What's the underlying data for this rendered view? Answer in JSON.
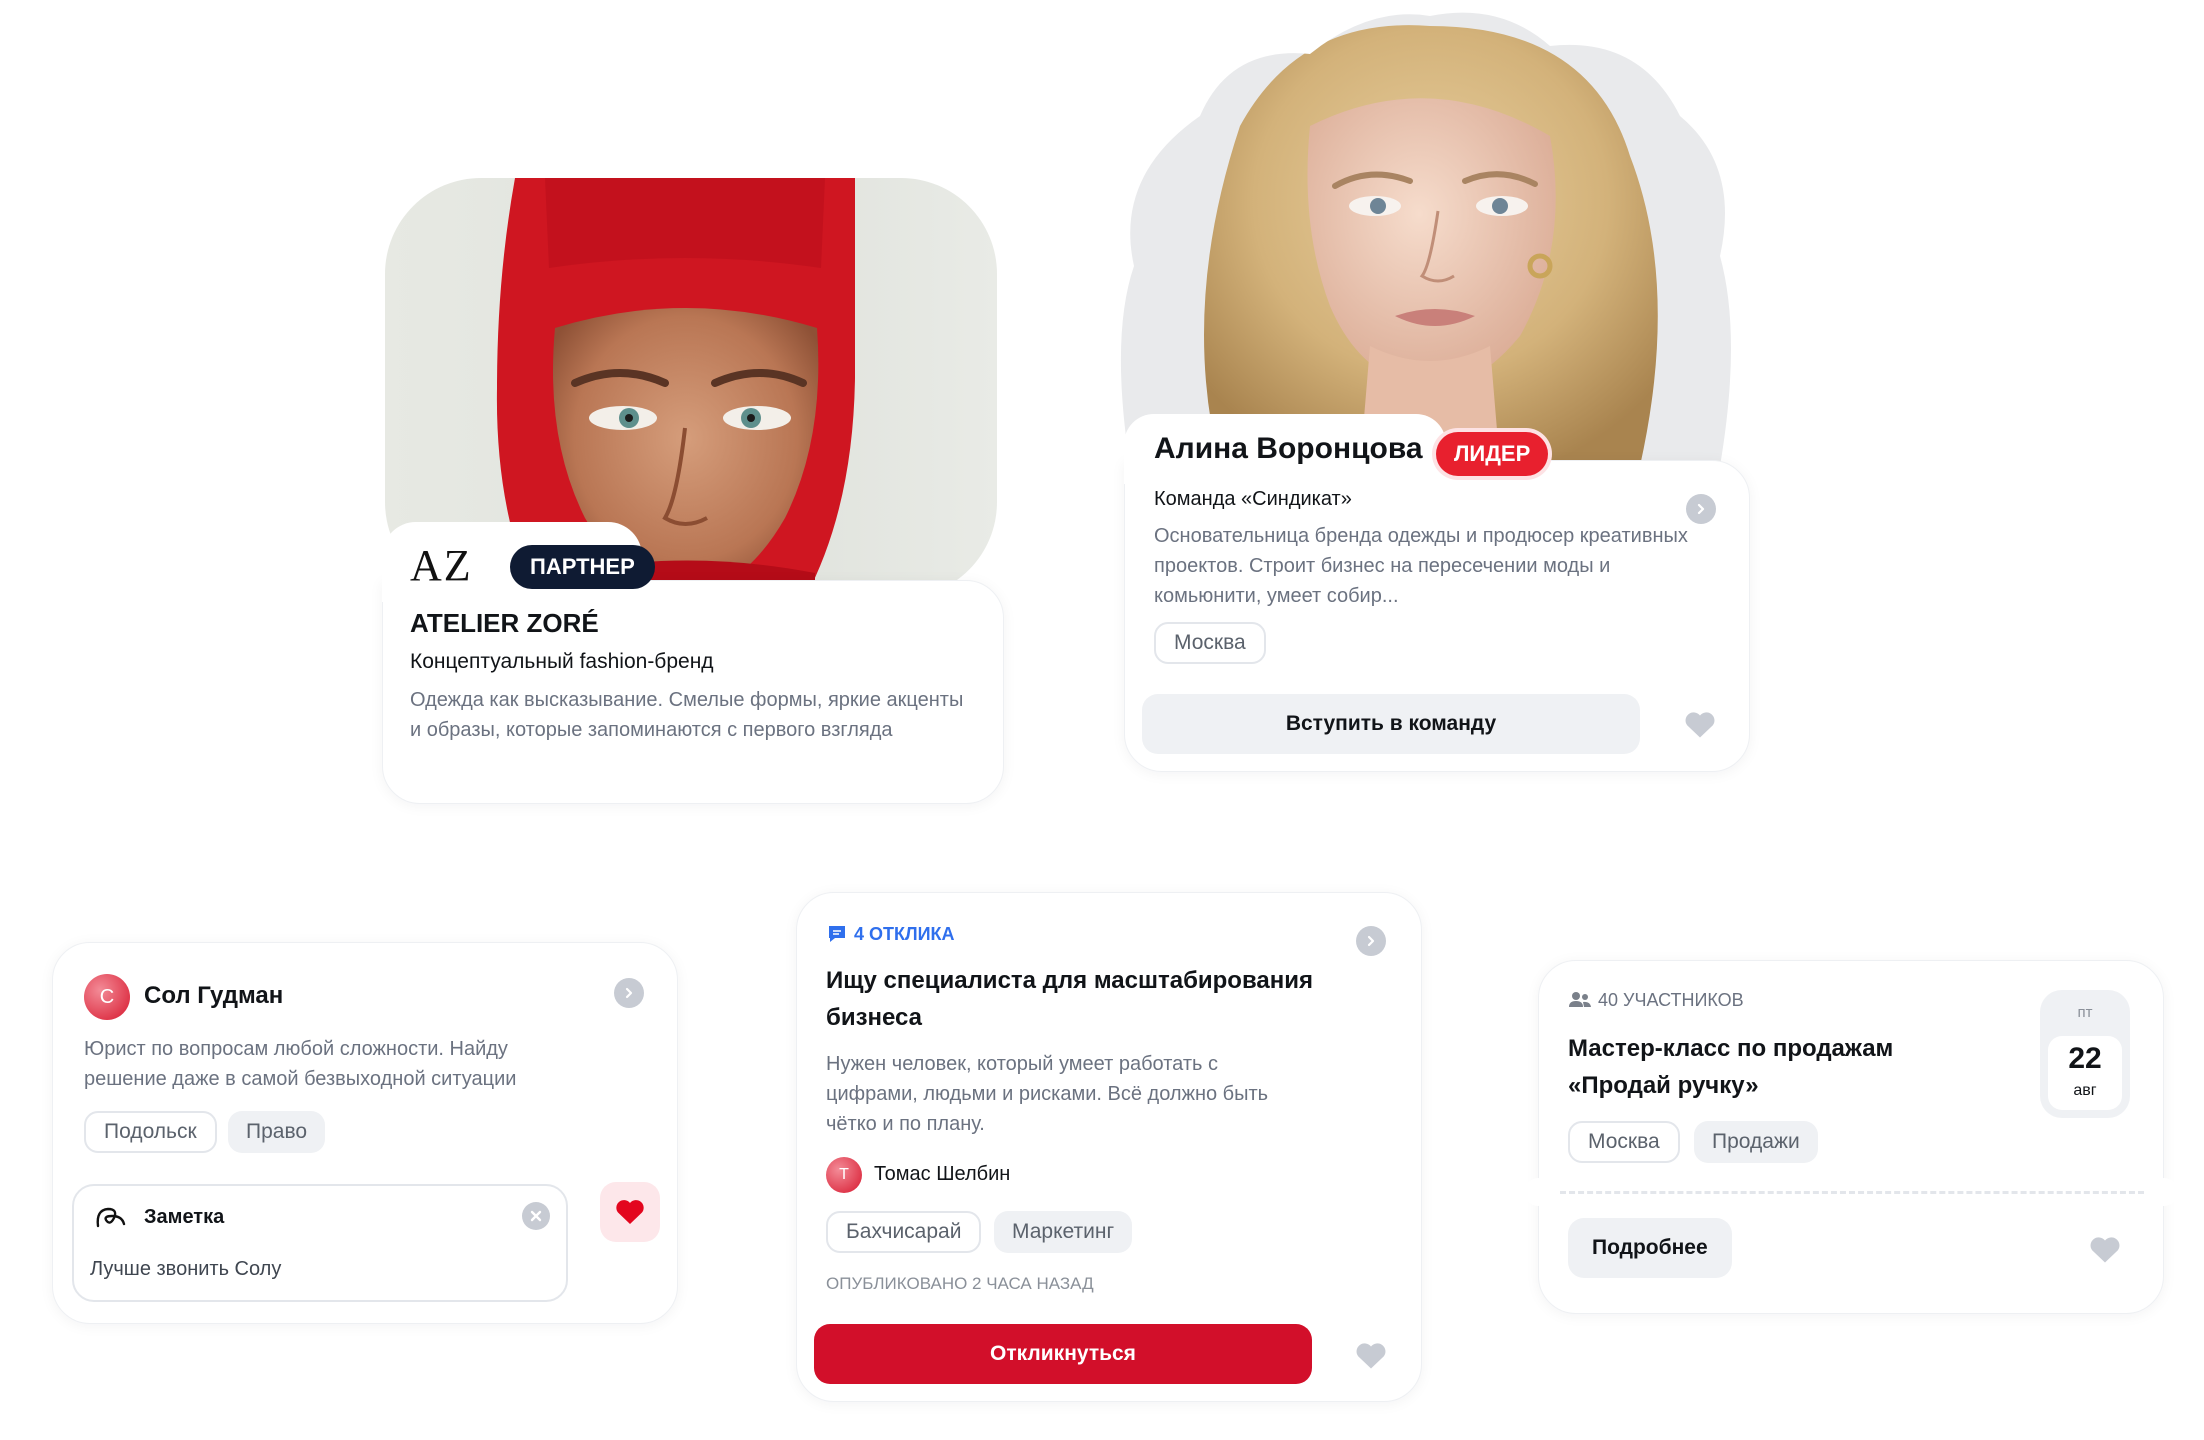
{
  "brand_card": {
    "logo_text": "AZ",
    "badge": "ПАРТНЕР",
    "title": "ATELIER ZORÉ",
    "subtitle": "Концептуальный fashion-бренд",
    "description": "Одежда как высказывание. Смелые формы, яркие акценты и образы, которые запоминаются с первого взгляда",
    "colors": {
      "badge_bg": "#0f1b33",
      "hat": "#d31822"
    }
  },
  "leader_card": {
    "name": "Алина Воронцова",
    "badge": "ЛИДЕР",
    "team": "Команда «Синдикат»",
    "description": "Основательница бренда одежды и продюсер креативных проектов. Строит бизнес на пересечении моды и комьюнити, умеет собир...",
    "tag": "Москва",
    "button": "Вступить в команду",
    "colors": {
      "badge_bg": "#e8202e"
    }
  },
  "person_card": {
    "avatar_letter": "С",
    "name": "Сол Гудман",
    "description": "Юрист по вопросам любой сложности. Найду решение даже в самой безвыходной ситуации",
    "tags": [
      "Подольск",
      "Право"
    ],
    "note": {
      "title": "Заметка",
      "text": "Лучше звонить Солу"
    },
    "colors": {
      "heart_active": "#e3061e",
      "heart_bg": "#fde7ea"
    }
  },
  "request_card": {
    "responses": "4 ОТКЛИКА",
    "title": "Ищу специалиста для масштабирования бизнеса",
    "description": "Нужен человек, который умеет работать с цифрами, людьми и рисками. Всё должно быть чётко и по плану.",
    "author_letter": "Т",
    "author": "Томас Шелбин",
    "tags": [
      "Бахчисарай",
      "Маркетинг"
    ],
    "published": "ОПУБЛИКОВАНО 2 ЧАСА НАЗАД",
    "button": "Откликнуться",
    "colors": {
      "accent": "#d20f2a",
      "responses": "#2f6fed"
    }
  },
  "event_card": {
    "participants": "40 УЧАСТНИКОВ",
    "title": "Мастер-класс по продажам «Продай ручку»",
    "date": {
      "weekday": "пт",
      "day": "22",
      "month": "авг"
    },
    "tags": [
      "Москва",
      "Продажи"
    ],
    "button": "Подробнее"
  }
}
